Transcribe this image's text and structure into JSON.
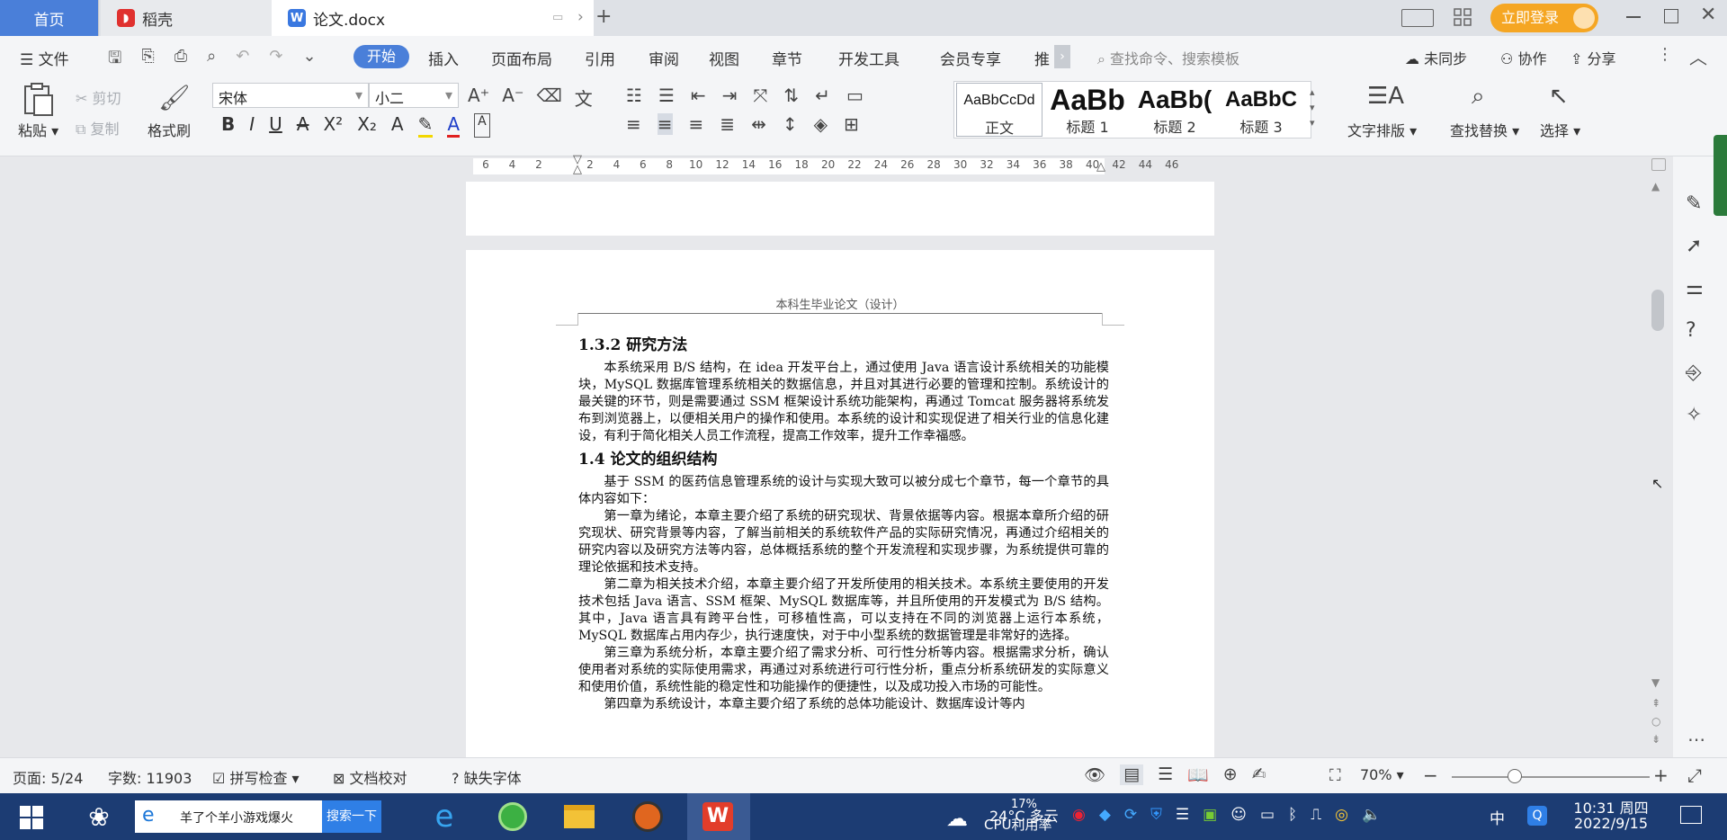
{
  "titlebar": {
    "tabs": [
      {
        "label": "首页"
      },
      {
        "label": "稻壳"
      },
      {
        "label": "论文.docx"
      }
    ],
    "login_button": "立即登录"
  },
  "menu": {
    "file": "文件",
    "items": [
      "开始",
      "插入",
      "页面布局",
      "引用",
      "审阅",
      "视图",
      "章节",
      "开发工具",
      "会员专享",
      "推"
    ],
    "search_placeholder": "查找命令、搜索模板",
    "sync": "未同步",
    "collab": "协作",
    "share": "分享"
  },
  "ribbon": {
    "paste": "粘贴",
    "cut": "剪切",
    "copy": "复制",
    "format_painter": "格式刷",
    "font_name": "宋体",
    "font_size": "小二",
    "styles": [
      {
        "preview": "AaBbCcDd",
        "name": "正文"
      },
      {
        "preview": "AaBb",
        "name": "标题 1"
      },
      {
        "preview": "AaBb(",
        "name": "标题 2"
      },
      {
        "preview": "AaBbC",
        "name": "标题 3"
      }
    ],
    "text_layout": "文字排版",
    "find_replace": "查找替换",
    "select": "选择"
  },
  "ruler": {
    "ticks": [
      "6",
      "4",
      "2",
      "2",
      "4",
      "6",
      "8",
      "10",
      "12",
      "14",
      "16",
      "18",
      "20",
      "22",
      "24",
      "26",
      "28",
      "30",
      "32",
      "34",
      "36",
      "38",
      "40",
      "42",
      "44",
      "46"
    ]
  },
  "document": {
    "header": "本科生毕业论文（设计）",
    "h_132": "1.3.2 研究方法",
    "p1": "本系统采用 B/S 结构，在 idea 开发平台上，通过使用 Java 语言设计系统相关的功能模块，MySQL 数据库管理系统相关的数据信息，并且对其进行必要的管理和控制。系统设计的最关键的环节，则是需要通过 SSM 框架设计系统功能架构，再通过 Tomcat 服务器将系统发布到浏览器上，以便相关用户的操作和使用。本系统的设计和实现促进了相关行业的信息化建设，有利于简化相关人员工作流程，提高工作效率，提升工作幸福感。",
    "h_14": "1.4 论文的组织结构",
    "p2": "基于 SSM 的医药信息管理系统的设计与实现大致可以被分成七个章节，每一个章节的具体内容如下：",
    "p3": "第一章为绪论，本章主要介绍了系统的研究现状、背景依据等内容。根据本章所介绍的研究现状、研究背景等内容，了解当前相关的系统软件产品的实际研究情况，再通过介绍相关的研究内容以及研究方法等内容，总体概括系统的整个开发流程和实现步骤，为系统提供可靠的理论依据和技术支持。",
    "p4": "第二章为相关技术介绍，本章主要介绍了开发所使用的相关技术。本系统主要使用的开发技术包括 Java 语言、SSM 框架、MySQL 数据库等，并且所使用的开发模式为 B/S 结构。其中，Java 语言具有跨平台性，可移植性高，可以支持在不同的浏览器上运行本系统，MySQL 数据库占用内存少，执行速度快，对于中小型系统的数据管理是非常好的选择。",
    "p5": "第三章为系统分析，本章主要介绍了需求分析、可行性分析等内容。根据需求分析，确认使用者对系统的实际使用需求，再通过对系统进行可行性分析，重点分析系统研发的实际意义和使用价值，系统性能的稳定性和功能操作的便捷性，以及成功投入市场的可能性。",
    "p6": "第四章为系统设计，本章主要介绍了系统的总体功能设计、数据库设计等内"
  },
  "status": {
    "page": "页面: 5/24",
    "words": "字数: 11903",
    "spell": "拼写检查",
    "proof": "文档校对",
    "missing_font": "缺失字体",
    "zoom": "70%"
  },
  "taskbar": {
    "search_text": "羊了个羊小游戏爆火",
    "search_button": "搜索一下",
    "weather": "24°C 多云",
    "cpu_pct": "17%",
    "cpu_label": "CPU利用率",
    "ime": "中",
    "time": "10:31 周四",
    "date": "2022/9/15"
  },
  "colors": {
    "accent": "#4a7fd9",
    "login": "#f5a623",
    "taskbar": "#1c3c73"
  }
}
